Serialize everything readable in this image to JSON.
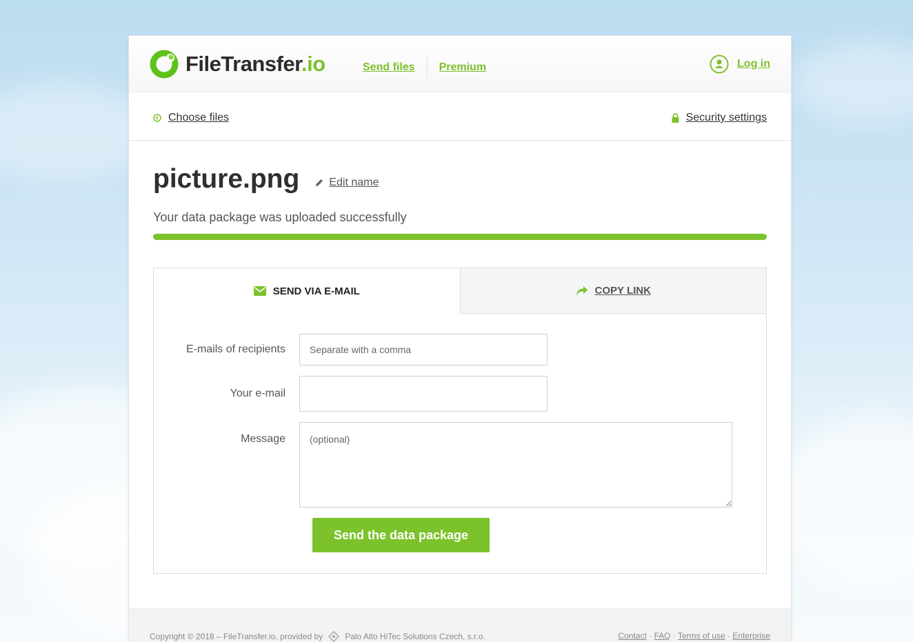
{
  "colors": {
    "accent": "#7cc22b",
    "text": "#333333"
  },
  "header": {
    "logo_main": "FileTransfer",
    "logo_tld": ".io",
    "nav": [
      {
        "label": "Send files"
      },
      {
        "label": "Premium"
      }
    ],
    "login_label": "Log in",
    "login_icon": "user-circle-icon"
  },
  "subbar": {
    "choose_files": "Choose files",
    "choose_icon": "back-arrow-circle-icon",
    "security_settings": "Security settings",
    "security_icon": "lock-icon"
  },
  "file": {
    "name": "picture.png",
    "edit_label": "Edit name",
    "status": "Your data package was uploaded successfully",
    "progress": 1.0
  },
  "tabs": [
    {
      "label": "SEND VIA E-MAIL",
      "icon": "envelope-icon",
      "active": true
    },
    {
      "label": "COPY LINK",
      "icon": "share-arrow-icon",
      "active": false
    }
  ],
  "form": {
    "recipients_label": "E-mails of recipients",
    "recipients_placeholder": "Separate with a comma",
    "recipients_value": "",
    "your_email_label": "Your e-mail",
    "your_email_value": "",
    "message_label": "Message",
    "message_placeholder": "(optional)",
    "message_value": "",
    "submit_label": "Send the data package"
  },
  "footer": {
    "copyright": "Copyright © 2018 – FileTransfer.io, provided by",
    "provider": "Palo Alto HiTec Solutions Czech, s.r.o.",
    "links": [
      {
        "label": "Contact"
      },
      {
        "label": "FAQ"
      },
      {
        "label": "Terms of use"
      },
      {
        "label": "Enterprise"
      }
    ],
    "separator": " · "
  }
}
